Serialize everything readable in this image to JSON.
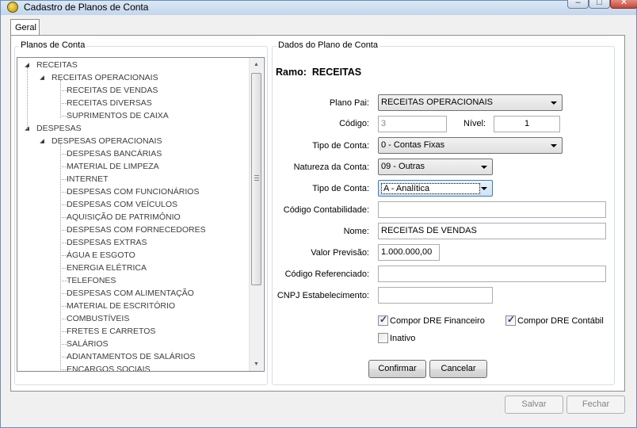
{
  "window": {
    "title": "Cadastro de Planos de Conta"
  },
  "tabs": [
    {
      "label": "Geral"
    }
  ],
  "left_panel": {
    "title": "Planos de Conta",
    "tree": [
      {
        "label": "RECEITAS",
        "level": 0,
        "expandable": true
      },
      {
        "label": "RECEITAS OPERACIONAIS",
        "level": 1,
        "expandable": true
      },
      {
        "label": "RECEITAS DE VENDAS",
        "level": 2
      },
      {
        "label": "RECEITAS DIVERSAS",
        "level": 2
      },
      {
        "label": "SUPRIMENTOS DE CAIXA",
        "level": 2
      },
      {
        "label": "DESPESAS",
        "level": 0,
        "expandable": true
      },
      {
        "label": "DESPESAS OPERACIONAIS",
        "level": 1,
        "expandable": true
      },
      {
        "label": "DESPESAS BANCÁRIAS",
        "level": 2
      },
      {
        "label": "MATERIAL DE LIMPEZA",
        "level": 2
      },
      {
        "label": "INTERNET",
        "level": 2
      },
      {
        "label": "DESPESAS COM FUNCIONÁRIOS",
        "level": 2
      },
      {
        "label": "DESPESAS COM VEÍCULOS",
        "level": 2
      },
      {
        "label": "AQUISIÇÃO DE PATRIMÔNIO",
        "level": 2
      },
      {
        "label": "DESPESAS COM FORNECEDORES",
        "level": 2
      },
      {
        "label": "DESPESAS EXTRAS",
        "level": 2
      },
      {
        "label": "ÁGUA E ESGOTO",
        "level": 2
      },
      {
        "label": "ENERGIA ELÉTRICA",
        "level": 2
      },
      {
        "label": "TELEFONES",
        "level": 2
      },
      {
        "label": "DESPESAS COM ALIMENTAÇÃO",
        "level": 2
      },
      {
        "label": "MATERIAL DE ESCRITÓRIO",
        "level": 2
      },
      {
        "label": "COMBUSTÍVEIS",
        "level": 2
      },
      {
        "label": "FRETES E CARRETOS",
        "level": 2
      },
      {
        "label": "SALÁRIOS",
        "level": 2
      },
      {
        "label": "ADIANTAMENTOS DE SALÁRIOS",
        "level": 2
      },
      {
        "label": "ENCARGOS SOCIAIS",
        "level": 2
      }
    ]
  },
  "right_panel": {
    "title": "Dados do Plano de Conta",
    "ramo_label": "Ramo:",
    "ramo_value": "RECEITAS",
    "fields": {
      "plano_pai": {
        "label": "Plano Pai:",
        "value": "RECEITAS OPERACIONAIS"
      },
      "codigo": {
        "label": "Código:",
        "value": "3"
      },
      "nivel": {
        "label": "Nível:",
        "value": "1"
      },
      "tipo_conta_1": {
        "label": "Tipo de Conta:",
        "value": "0 - Contas Fixas"
      },
      "natureza": {
        "label": "Natureza da Conta:",
        "value": "09 - Outras"
      },
      "tipo_conta_2": {
        "label": "Tipo de Conta:",
        "value": "A - Analítica"
      },
      "codigo_contabilidade": {
        "label": "Código Contabilidade:",
        "value": ""
      },
      "nome": {
        "label": "Nome:",
        "value": "RECEITAS DE VENDAS"
      },
      "valor_previsao": {
        "label": "Valor Previsão:",
        "value": "1.000.000,00"
      },
      "codigo_referenciado": {
        "label": "Código Referenciado:",
        "value": ""
      },
      "cnpj": {
        "label": "CNPJ Estabelecimento:",
        "value": ""
      }
    },
    "checkboxes": {
      "dre_financeiro": {
        "label": "Compor DRE Financeiro",
        "checked": true
      },
      "dre_contabil": {
        "label": "Compor DRE Contábil",
        "checked": true
      },
      "inativo": {
        "label": "Inativo",
        "checked": false
      }
    },
    "buttons": {
      "confirmar": "Confirmar",
      "cancelar": "Cancelar"
    }
  },
  "footer": {
    "salvar": "Salvar",
    "fechar": "Fechar"
  }
}
